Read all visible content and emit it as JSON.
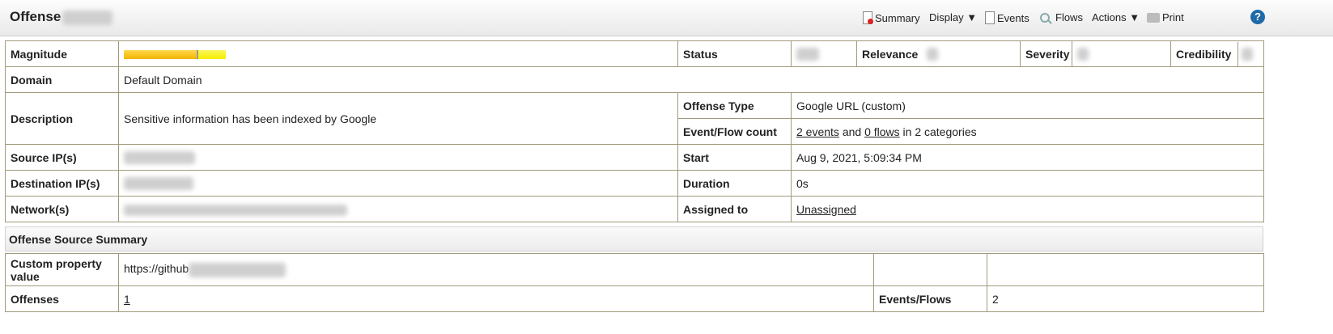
{
  "header": {
    "title": "Offense",
    "toolbar": {
      "summary": "Summary",
      "display": "Display ▼",
      "events": "Events",
      "flows": "Flows",
      "actions": "Actions ▼",
      "print": "Print"
    },
    "help": "?"
  },
  "offense": {
    "magnitude_label": "Magnitude",
    "magnitude_colors": [
      "#f2b400",
      "#f5ee00"
    ],
    "status_label": "Status",
    "relevance_label": "Relevance",
    "severity_label": "Severity",
    "credibility_label": "Credibility",
    "domain_label": "Domain",
    "domain_value": "Default Domain",
    "description_label": "Description",
    "description_value": "Sensitive information has been indexed by Google",
    "offense_type_label": "Offense Type",
    "offense_type_value": "Google URL (custom)",
    "event_flow_count_label": "Event/Flow count",
    "events_link": "2 events",
    "and_text": "and",
    "flows_link": "0 flows",
    "categories_text": "in 2 categories",
    "source_ip_label": "Source IP(s)",
    "start_label": "Start",
    "start_value": "Aug 9, 2021, 5:09:34 PM",
    "destination_ip_label": "Destination IP(s)",
    "duration_label": "Duration",
    "duration_value": "0s",
    "networks_label": "Network(s)",
    "assigned_to_label": "Assigned to",
    "assigned_to_value": "Unassigned"
  },
  "source_summary": {
    "title": "Offense Source Summary",
    "custom_property_label": "Custom property value",
    "custom_property_value": "https://github",
    "offenses_label": "Offenses",
    "offenses_value": "1",
    "events_flows_label": "Events/Flows",
    "events_flows_value": "2"
  }
}
